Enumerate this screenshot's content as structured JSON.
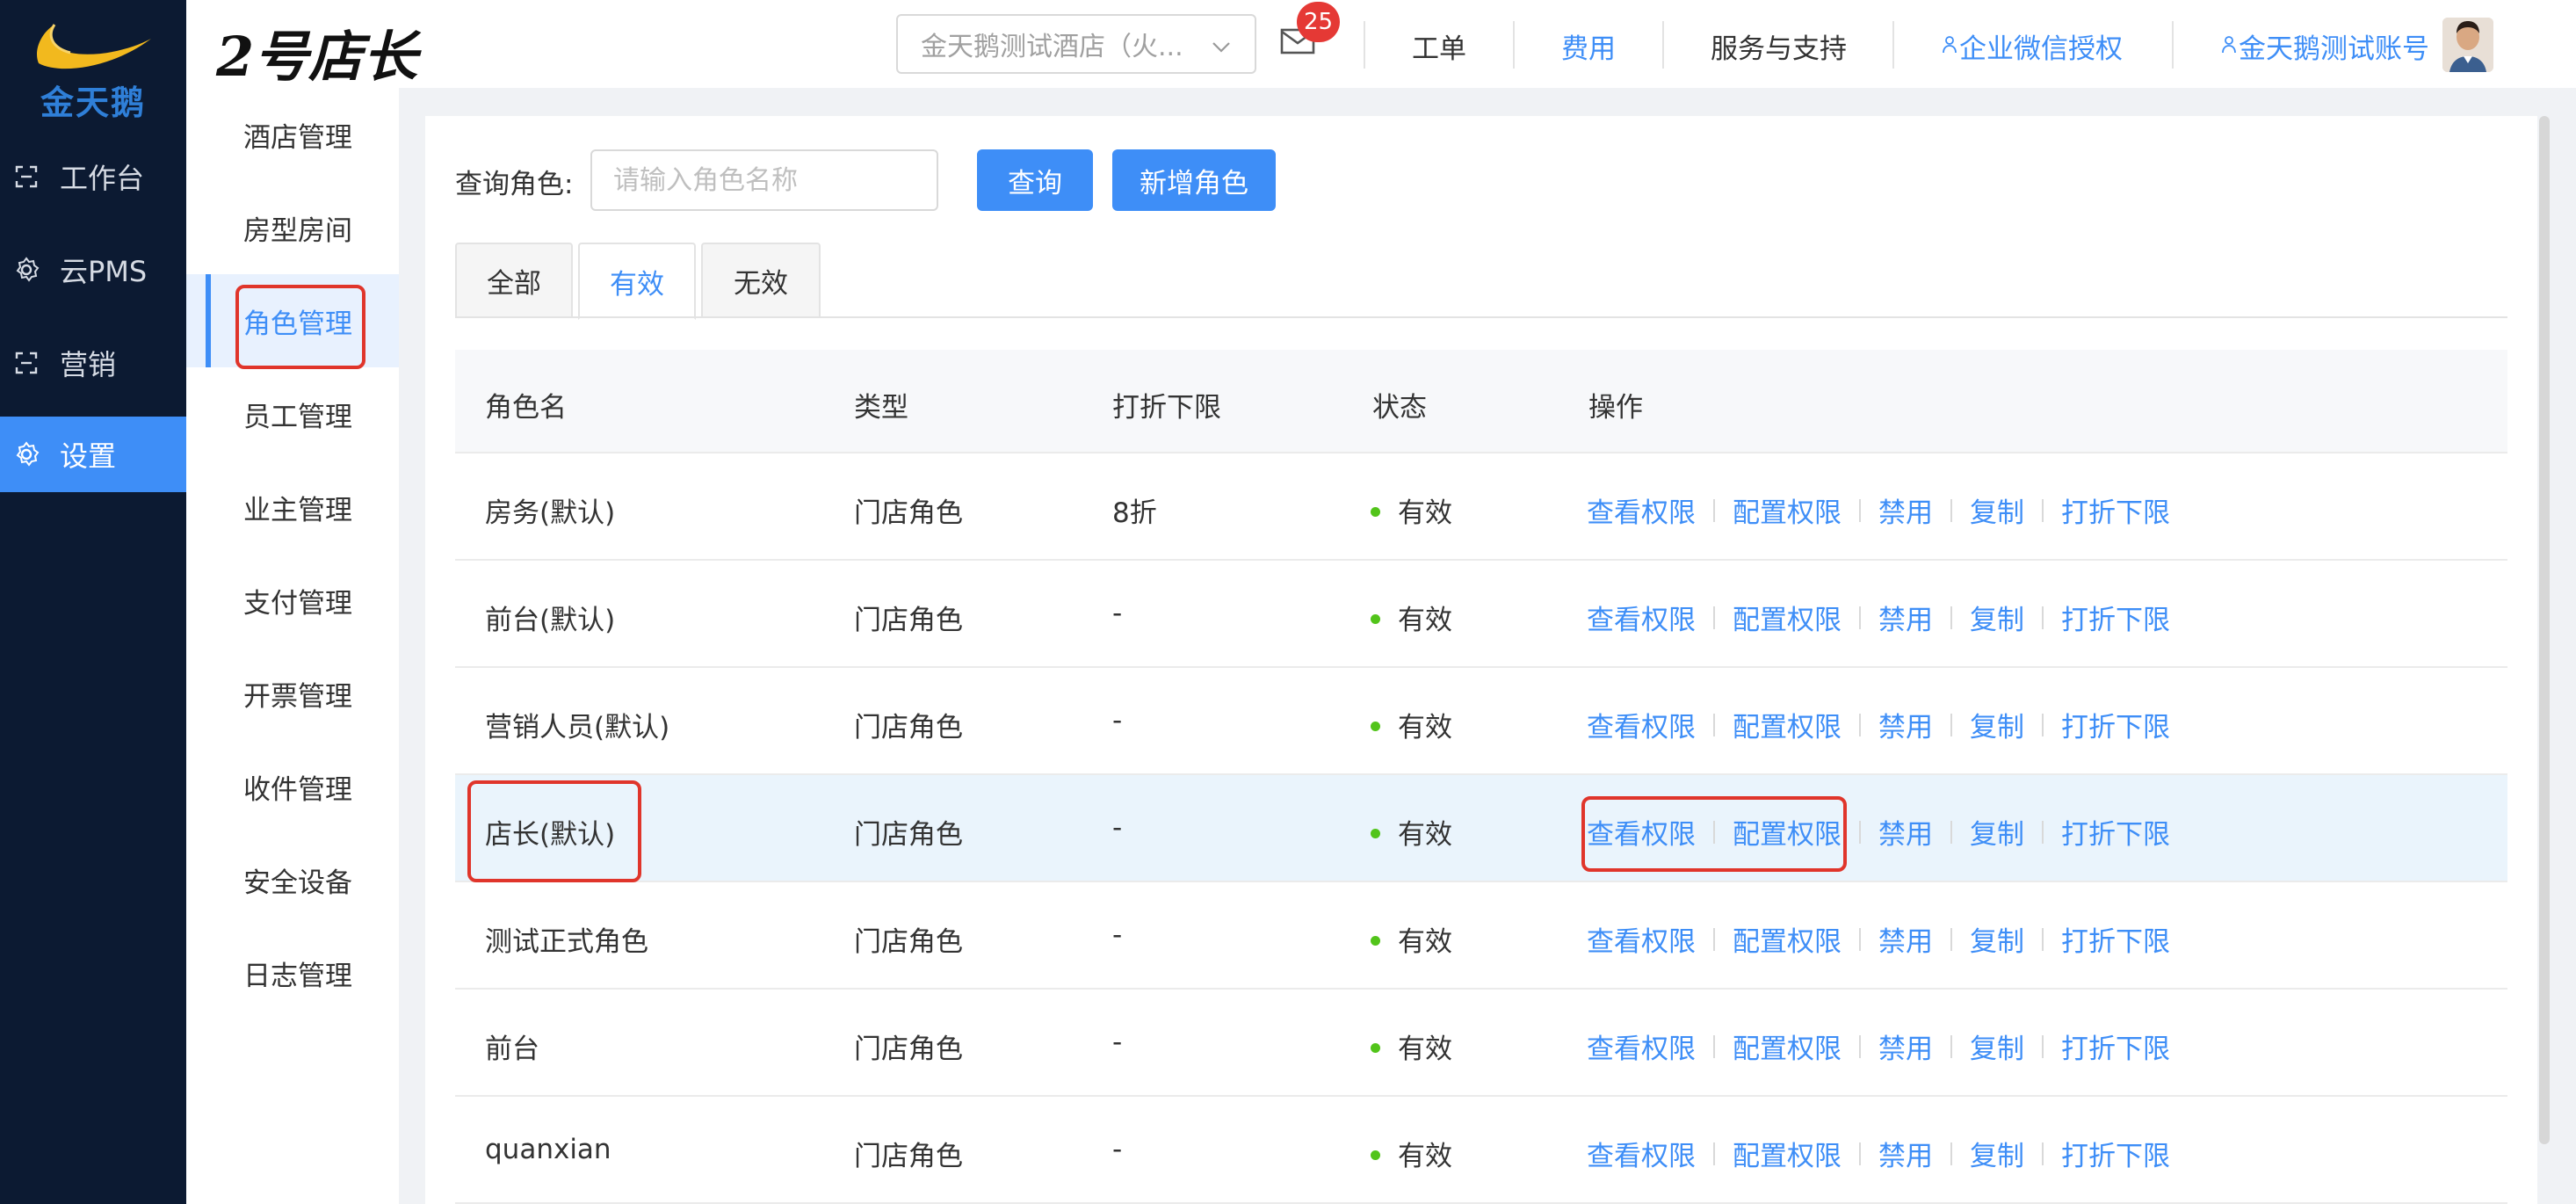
{
  "sidebar": {
    "logo_text": "金天鹅",
    "items": [
      {
        "label": "工作台",
        "icon": "workbench-icon"
      },
      {
        "label": "云PMS",
        "icon": "gear-icon"
      },
      {
        "label": "营销",
        "icon": "marketing-icon"
      },
      {
        "label": "设置",
        "icon": "settings-gear-icon",
        "active": true
      }
    ]
  },
  "header": {
    "brand": "2号店长",
    "hotel_select": "金天鹅测试酒店（火...",
    "mail_badge": "25",
    "nav": [
      "工单",
      "费用",
      "服务与支持",
      "企业微信授权",
      "金天鹅测试账号"
    ]
  },
  "submenu": {
    "items": [
      "酒店管理",
      "房型房间",
      "角色管理",
      "员工管理",
      "业主管理",
      "支付管理",
      "开票管理",
      "收件管理",
      "安全设备",
      "日志管理"
    ],
    "active_index": 2
  },
  "query": {
    "label": "查询角色:",
    "placeholder": "请输入角色名称",
    "search_button": "查询",
    "add_button": "新增角色"
  },
  "tabs": [
    "全部",
    "有效",
    "无效"
  ],
  "table": {
    "headers": [
      "角色名",
      "类型",
      "打折下限",
      "状态",
      "操作"
    ],
    "ops": [
      "查看权限",
      "配置权限",
      "禁用",
      "复制",
      "打折下限"
    ],
    "rows": [
      {
        "name": "房务(默认)",
        "type": "门店角色",
        "discount": "8折",
        "status": "有效"
      },
      {
        "name": "前台(默认)",
        "type": "门店角色",
        "discount": "-",
        "status": "有效"
      },
      {
        "name": "营销人员(默认)",
        "type": "门店角色",
        "discount": "-",
        "status": "有效"
      },
      {
        "name": "店长(默认)",
        "type": "门店角色",
        "discount": "-",
        "status": "有效"
      },
      {
        "name": "测试正式角色",
        "type": "门店角色",
        "discount": "-",
        "status": "有效"
      },
      {
        "name": "前台",
        "type": "门店角色",
        "discount": "-",
        "status": "有效"
      },
      {
        "name": "quanxian",
        "type": "门店角色",
        "discount": "-",
        "status": "有效"
      }
    ]
  },
  "colors": {
    "sidebar_bg": "#0c1a32",
    "accent": "#3e8ef7",
    "highlight_border": "#e0352b",
    "status_green": "#52c41a",
    "badge_red": "#e53935"
  }
}
